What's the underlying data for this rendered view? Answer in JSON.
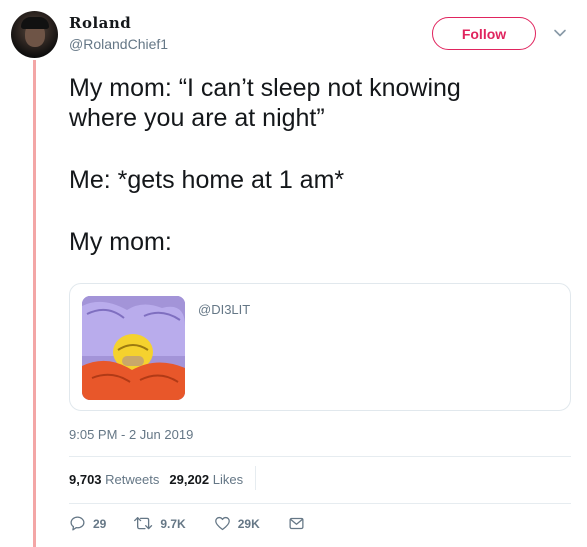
{
  "user": {
    "display_name": "Roland",
    "handle": "@RolandChief1"
  },
  "follow_label": "Follow",
  "tweet": {
    "lines": [
      "My mom: “I can’t sleep not knowing",
      "where you are at night”",
      "Me: *gets home at 1 am*",
      "My mom:"
    ]
  },
  "media": {
    "source_handle": "@DI3LIT"
  },
  "timestamp": "9:05 PM - 2 Jun 2019",
  "stats": {
    "retweets_count": "9,703",
    "retweets_label": "Retweets",
    "likes_count": "29,202",
    "likes_label": "Likes"
  },
  "actions": {
    "replies": "29",
    "retweets": "9.7K",
    "likes": "29K"
  },
  "colors": {
    "accent": "#e0245e",
    "thread_line": "#f3a6a6",
    "secondary_text": "#657786"
  },
  "icons": {
    "reply": "reply-icon",
    "retweet": "retweet-icon",
    "like": "heart-icon",
    "message": "envelope-icon",
    "more": "chevron-down-icon"
  }
}
